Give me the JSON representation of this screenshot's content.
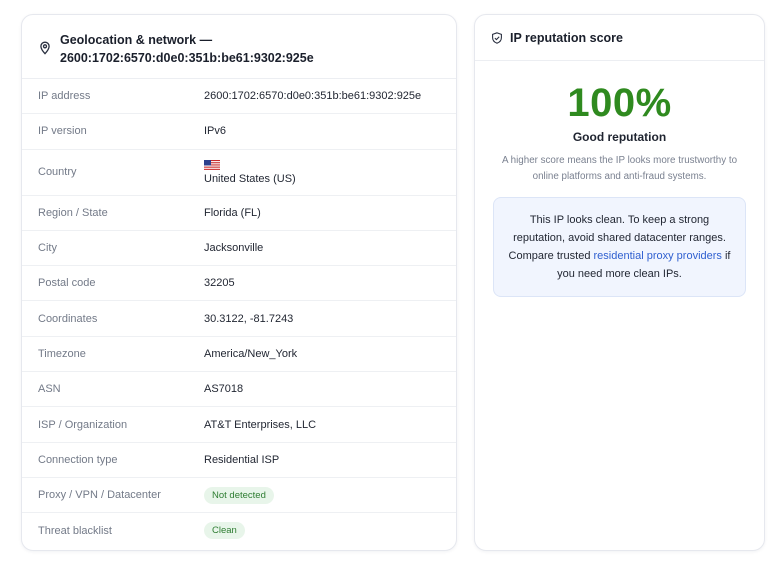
{
  "geo": {
    "title_line1": "Geolocation & network —",
    "title_line2": "2600:1702:6570:d0e0:351b:be61:9302:925e",
    "icon": "location-pin-icon",
    "rows": [
      {
        "label": "IP address",
        "value": "2600:1702:6570:d0e0:351b:be61:9302:925e"
      },
      {
        "label": "IP version",
        "value": "IPv6"
      },
      {
        "label": "Country",
        "value": "United States (US)",
        "flag": "us-flag-icon"
      },
      {
        "label": "Region / State",
        "value": "Florida (FL)"
      },
      {
        "label": "City",
        "value": "Jacksonville"
      },
      {
        "label": "Postal code",
        "value": "32205"
      },
      {
        "label": "Coordinates",
        "value": "30.3122, -81.7243"
      },
      {
        "label": "Timezone",
        "value": "America/New_York"
      },
      {
        "label": "ASN",
        "value": "AS7018"
      },
      {
        "label": "ISP / Organization",
        "value": "AT&T Enterprises, LLC"
      },
      {
        "label": "Connection type",
        "value": "Residential ISP"
      },
      {
        "label": "Proxy / VPN / Datacenter",
        "value": "Not detected",
        "badge": true
      },
      {
        "label": "Threat blacklist",
        "value": "Clean",
        "badge": true
      }
    ]
  },
  "reputation": {
    "title": "IP reputation score",
    "icon": "shield-check-icon",
    "score": "100%",
    "verdict": "Good reputation",
    "explanation": "A higher score means the IP looks more trustworthy to online platforms and anti-fraud systems.",
    "note_before": "This IP looks clean. To keep a strong reputation, avoid shared datacenter ranges. Compare trusted ",
    "note_link": "residential proxy providers",
    "note_after": " if you need more clean IPs."
  },
  "colors": {
    "score_green": "#2f8a1f",
    "badge_bg": "#e8f5ea",
    "badge_text": "#2e7d32",
    "link_blue": "#2f5fd0",
    "note_bg": "#f1f5fe"
  }
}
